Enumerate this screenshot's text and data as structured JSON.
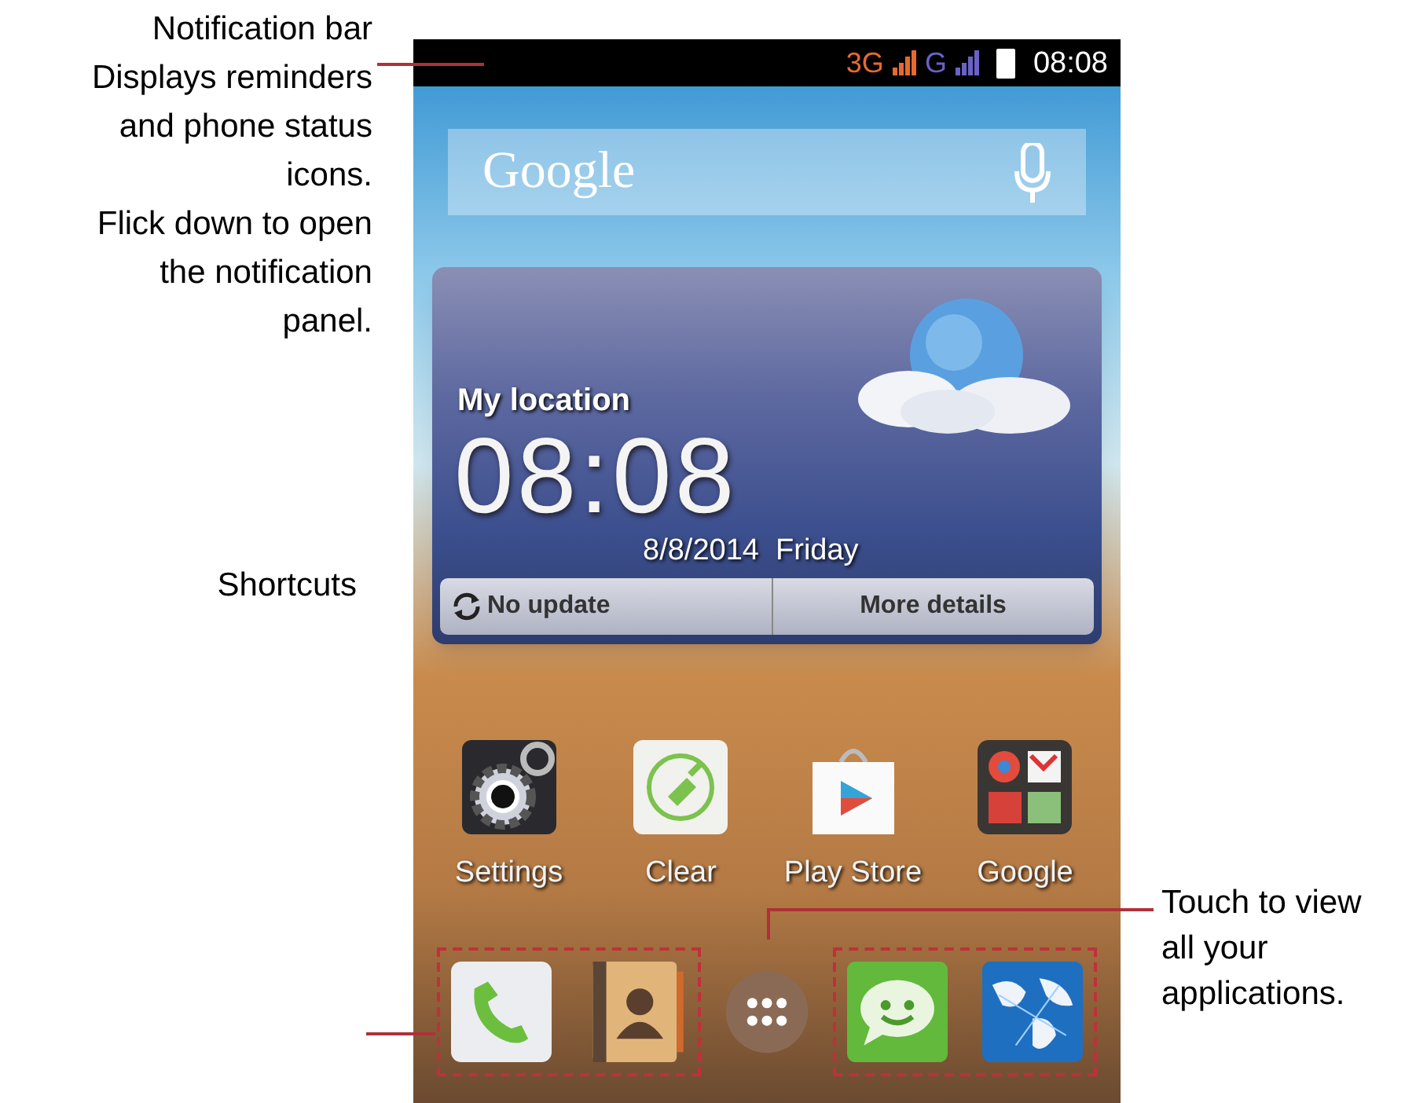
{
  "callouts": [
    {
      "kind": "notification",
      "title": "Notification bar",
      "text": "Displays reminders\nand phone status\nicons.\nFlick down to open\nthe notification\npanel."
    },
    {
      "kind": "shortcuts",
      "text": "Shortcuts"
    },
    {
      "kind": "launcher",
      "text": "Touch to view\nall your\napplications."
    }
  ],
  "status_bar": {
    "networks": [
      {
        "label": "3G",
        "color": "#e8692e"
      },
      {
        "label": "G",
        "color": "#6a62c4"
      }
    ],
    "time": "08:08"
  },
  "search_bar": {
    "label": "Google"
  },
  "weather_widget": {
    "location": "My location",
    "time": "08:08",
    "date": "8/8/2014  Friday",
    "buttons": [
      {
        "kind": "refresh",
        "label": "No update"
      },
      {
        "kind": "details",
        "label": "More details"
      }
    ]
  },
  "apps": [
    {
      "kind": "settings",
      "label": "Settings"
    },
    {
      "kind": "clear",
      "label": "Clear"
    },
    {
      "kind": "store",
      "label": "Play Store"
    },
    {
      "kind": "folder",
      "label": "Google"
    }
  ],
  "dock": [
    {
      "kind": "phone"
    },
    {
      "kind": "contacts"
    },
    {
      "kind": "launcher"
    },
    {
      "kind": "messaging"
    },
    {
      "kind": "browser"
    }
  ]
}
